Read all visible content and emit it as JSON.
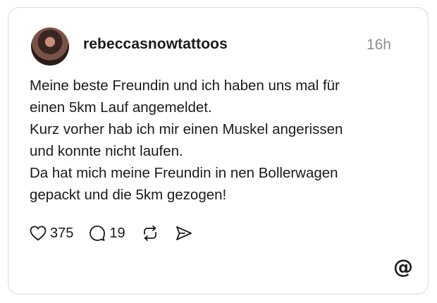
{
  "post": {
    "username": "rebeccasnowtattoos",
    "timestamp": "16h",
    "lines": [
      "Meine beste Freundin und ich haben uns mal für",
      "einen 5km Lauf angemeldet.",
      "Kurz vorher hab ich mir einen Muskel angerissen",
      "und konnte nicht laufen.",
      "Da hat mich meine Freundin in nen Bollerwagen",
      "gepackt und die 5km gezogen!"
    ]
  },
  "actions": {
    "likes": "375",
    "replies": "19"
  },
  "icons": {
    "like": "heart-icon",
    "reply": "comment-icon",
    "repost": "repost-icon",
    "share": "send-icon",
    "brand": "threads-logo-icon"
  }
}
